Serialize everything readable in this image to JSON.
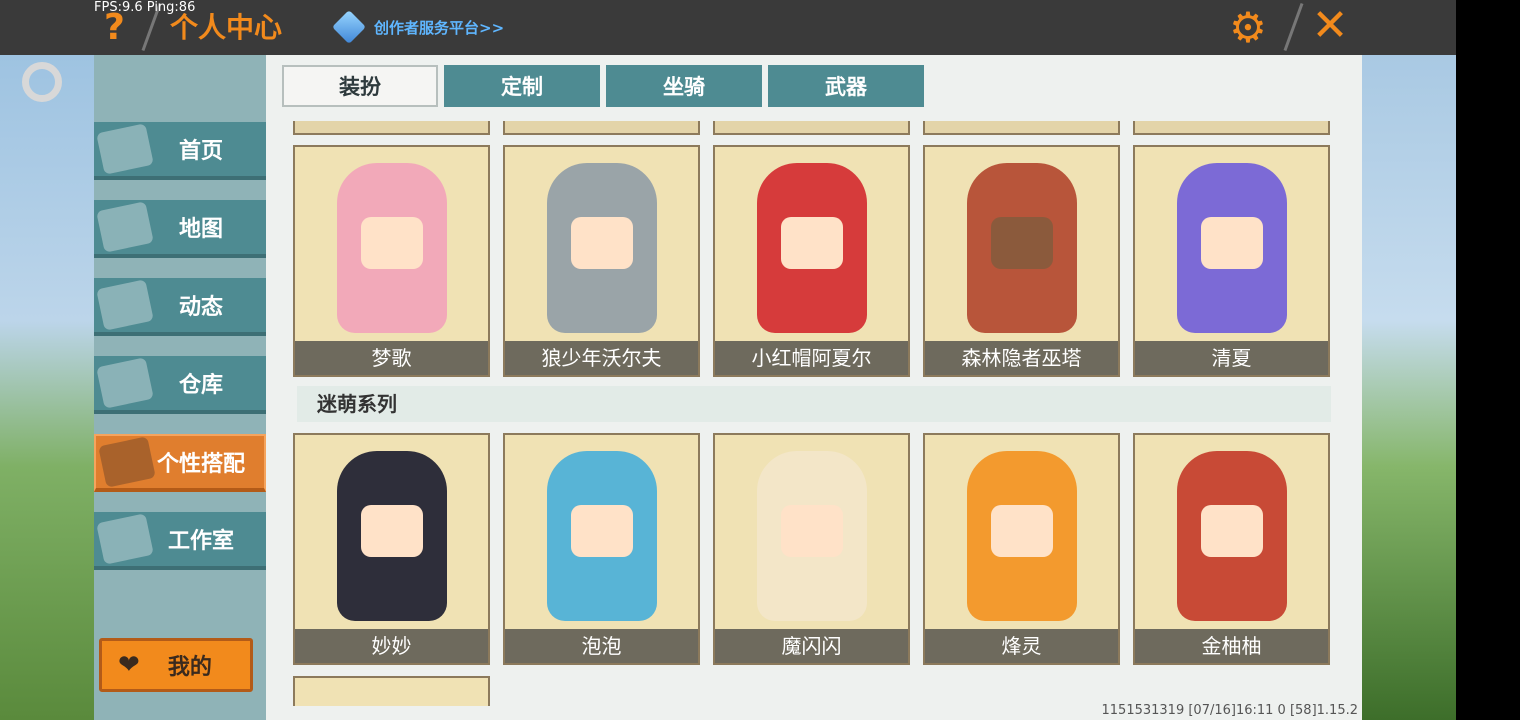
{
  "status": {
    "fps": "FPS:9.6",
    "ping": "Ping:86"
  },
  "header": {
    "title": "个人中心",
    "platform_link": "创作者服务平台>>",
    "help": "?",
    "settings_icon": "gear-icon",
    "close": "✕"
  },
  "sidebar": {
    "items": [
      {
        "label": "首页",
        "icon": "home-icon"
      },
      {
        "label": "地图",
        "icon": "map-icon"
      },
      {
        "label": "动态",
        "icon": "bell-icon"
      },
      {
        "label": "仓库",
        "icon": "warehouse-icon"
      },
      {
        "label": "个性搭配",
        "icon": "outfit-icon",
        "active": true
      },
      {
        "label": "工作室",
        "icon": "studio-icon"
      }
    ],
    "mine_label": "我的"
  },
  "tabs": [
    {
      "label": "装扮",
      "active": true
    },
    {
      "label": "定制"
    },
    {
      "label": "坐骑"
    },
    {
      "label": "武器"
    }
  ],
  "row1": [
    {
      "name": "梦歌",
      "color": "#f2a9b9"
    },
    {
      "name": "狼少年沃尔夫",
      "color": "#9aa4a8"
    },
    {
      "name": "小红帽阿夏尔",
      "color": "#d63b3b"
    },
    {
      "name": "森林隐者巫塔",
      "color": "#b8553a"
    },
    {
      "name": "清夏",
      "color": "#7c6ad6"
    }
  ],
  "section_title": "迷萌系列",
  "row2": [
    {
      "name": "妙妙",
      "color": "#2e2e3a"
    },
    {
      "name": "泡泡",
      "color": "#58b4d6"
    },
    {
      "name": "魔闪闪",
      "color": "#f3e6c8"
    },
    {
      "name": "烽灵",
      "color": "#f39a2e"
    },
    {
      "name": "金柚柚",
      "color": "#c84a36"
    }
  ],
  "version": "1151531319    [07/16]16:11 0    [58]1.15.2"
}
